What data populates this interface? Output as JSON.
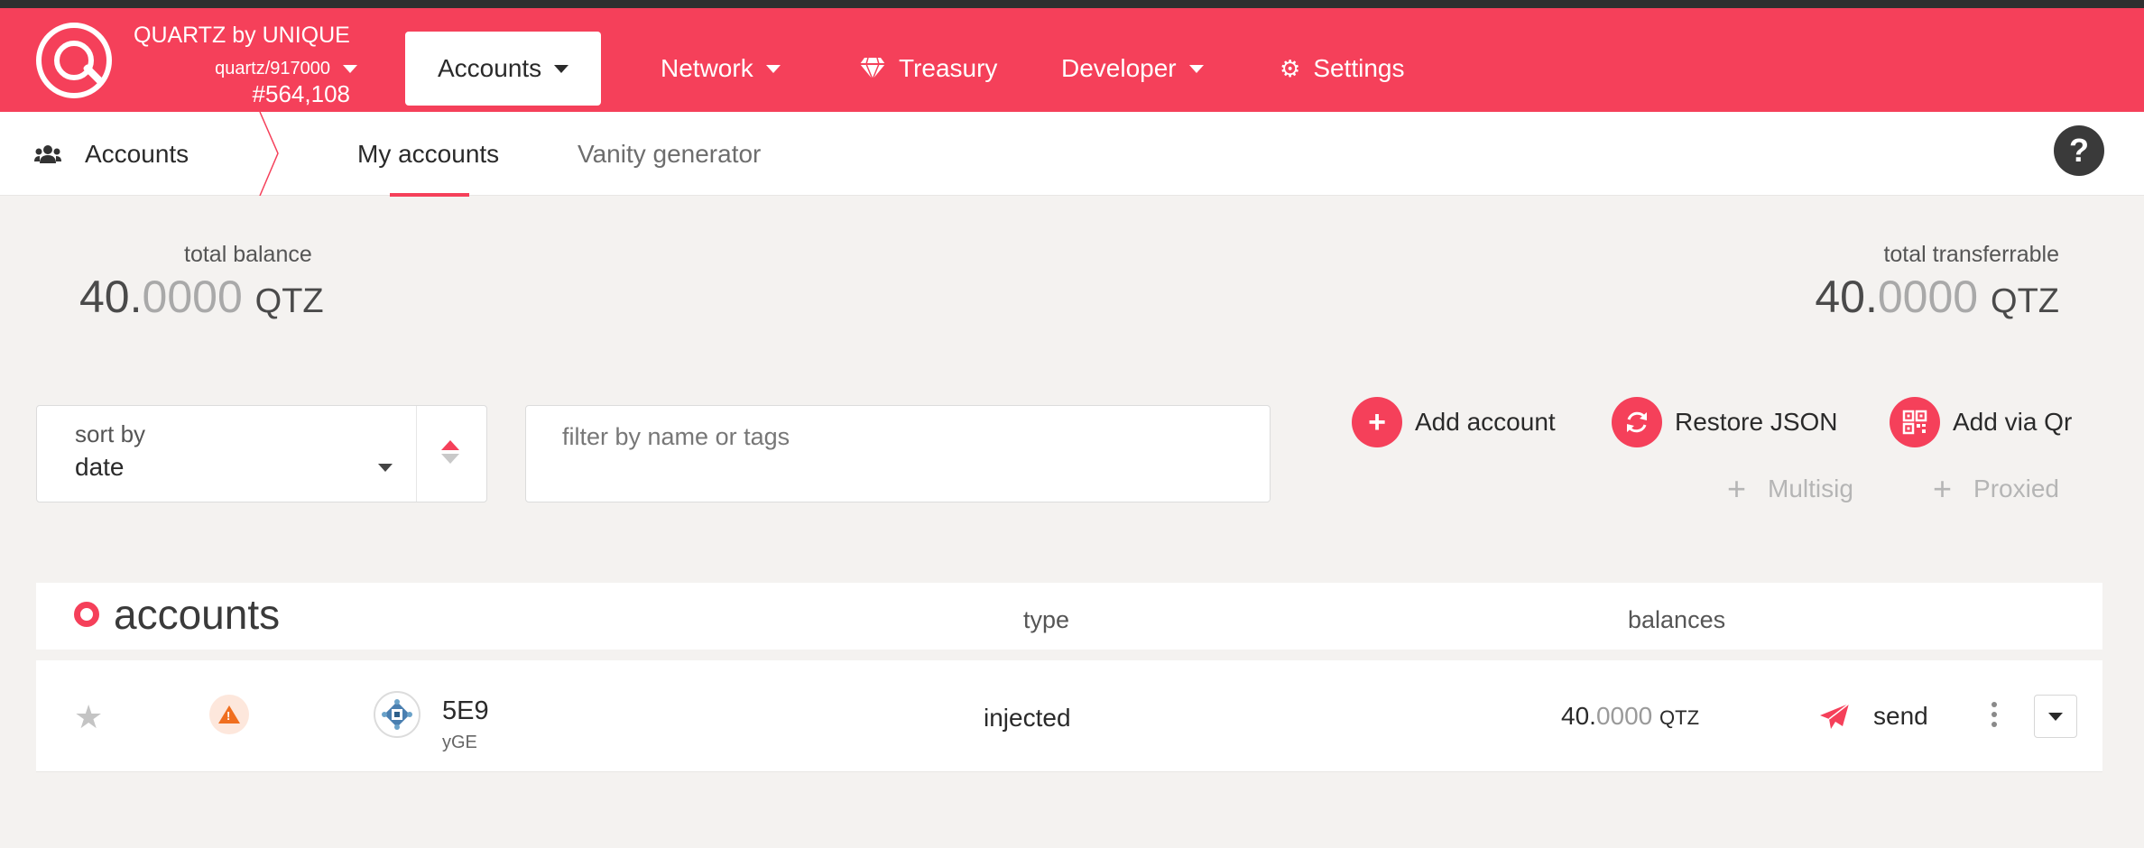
{
  "colors": {
    "brand": "#f5405a",
    "warning": "#f06e1f"
  },
  "chain": {
    "name": "QUARTZ by UNIQUE",
    "version": "quartz/917000",
    "block": "#564,108"
  },
  "nav": {
    "accounts": "Accounts",
    "network": "Network",
    "treasury": "Treasury",
    "developer": "Developer",
    "settings": "Settings"
  },
  "subnav": {
    "root": "Accounts",
    "tabs": [
      "My accounts",
      "Vanity generator"
    ],
    "help": "?"
  },
  "summary": {
    "total_balance": {
      "label": "total balance",
      "int": "40.",
      "dec": "0000",
      "unit": "QTZ"
    },
    "total_transferrable": {
      "label": "total transferrable",
      "int": "40.",
      "dec": "0000",
      "unit": "QTZ"
    }
  },
  "sort": {
    "label": "sort by",
    "value": "date"
  },
  "filter": {
    "placeholder": "filter by name or tags"
  },
  "actions": {
    "add_account": "Add account",
    "restore_json": "Restore JSON",
    "add_via_qr": "Add via Qr",
    "multisig": "Multisig",
    "proxied": "Proxied"
  },
  "table": {
    "title": "accounts",
    "columns": {
      "type": "type",
      "balances": "balances"
    },
    "rows": [
      {
        "name": "5E9",
        "sub": "yGE",
        "type": "injected",
        "balance_int": "40.",
        "balance_dec": "0000",
        "unit": "QTZ",
        "send": "send"
      }
    ]
  },
  "icons": {
    "logo": "quartz-logo-icon",
    "treasury": "gem-icon",
    "settings": "gears-icon",
    "accounts": "people-icon",
    "star": "star-icon",
    "warning": "warning-icon",
    "send": "paper-plane-icon"
  }
}
